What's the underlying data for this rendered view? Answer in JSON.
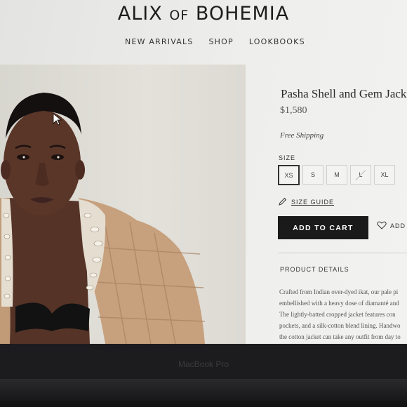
{
  "brand": {
    "main1": "ALIX",
    "of": "OF",
    "main2": "BOHEMIA"
  },
  "nav": [
    "NEW ARRIVALS",
    "SHOP",
    "LOOKBOOKS"
  ],
  "product": {
    "title": "Pasha Shell and Gem Jacket",
    "price": "$1,580",
    "shipping": "Free Shipping",
    "size_label": "SIZE",
    "sizes": [
      {
        "label": "XS",
        "selected": true,
        "available": true
      },
      {
        "label": "S",
        "selected": false,
        "available": true
      },
      {
        "label": "M",
        "selected": false,
        "available": true
      },
      {
        "label": "L",
        "selected": false,
        "available": false
      },
      {
        "label": "XL",
        "selected": false,
        "available": true
      }
    ],
    "size_guide": "SIZE GUIDE",
    "add_to_cart": "ADD TO CART",
    "wishlist": "ADD TO WISHLIST",
    "details_title": "PRODUCT DETAILS",
    "details_lines": [
      "Crafted from Indian over-dyed ikat, our pale pi",
      "embellished with a heavy dose of diamanté and",
      "The lightly-batted cropped jacket features con",
      "pockets, and a silk-cotton blend lining. Handwo",
      "the cotton jacket can take any outfit from day to"
    ]
  },
  "device_label": "MacBook Pro",
  "colors": {
    "button": "#1a1a1a",
    "text": "#2a2a2a",
    "jacket": "#c9a07c"
  }
}
